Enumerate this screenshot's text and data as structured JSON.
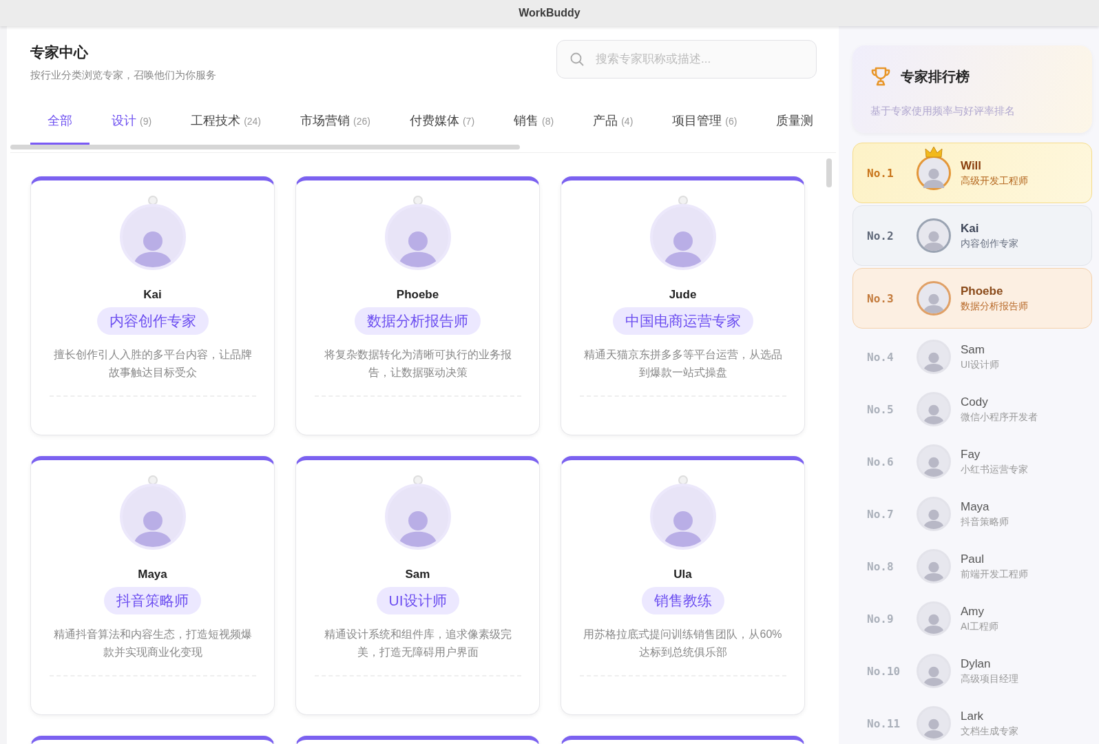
{
  "window": {
    "title": "WorkBuddy"
  },
  "header": {
    "title": "专家中心",
    "subtitle": "按行业分类浏览专家，召唤他们为你服务"
  },
  "search": {
    "placeholder": "搜索专家职称或描述..."
  },
  "tabs": [
    {
      "label": "全部",
      "selected": true,
      "hover": false
    },
    {
      "label": "设计",
      "count": "(9)",
      "selected": false,
      "hover": true
    },
    {
      "label": "工程技术",
      "count": "(24)",
      "selected": false,
      "hover": false
    },
    {
      "label": "市场营销",
      "count": "(26)",
      "selected": false,
      "hover": false
    },
    {
      "label": "付费媒体",
      "count": "(7)",
      "selected": false,
      "hover": false
    },
    {
      "label": "销售",
      "count": "(8)",
      "selected": false,
      "hover": false
    },
    {
      "label": "产品",
      "count": "(4)",
      "selected": false,
      "hover": false
    },
    {
      "label": "项目管理",
      "count": "(6)",
      "selected": false,
      "hover": false
    },
    {
      "label": "质量测",
      "selected": false,
      "hover": false
    }
  ],
  "experts": [
    {
      "name": "Kai",
      "role": "内容创作专家",
      "description": "擅长创作引人入胜的多平台内容，让品牌故事触达目标受众"
    },
    {
      "name": "Phoebe",
      "role": "数据分析报告师",
      "description": "将复杂数据转化为清晰可执行的业务报告，让数据驱动决策"
    },
    {
      "name": "Jude",
      "role": "中国电商运营专家",
      "description": "精通天猫京东拼多多等平台运营，从选品到爆款一站式操盘"
    },
    {
      "name": "Maya",
      "role": "抖音策略师",
      "description": "精通抖音算法和内容生态，打造短视频爆款并实现商业化变现"
    },
    {
      "name": "Sam",
      "role": "UI设计师",
      "description": "精通设计系统和组件库，追求像素级完美，打造无障碍用户界面"
    },
    {
      "name": "Ula",
      "role": "销售教练",
      "description": "用苏格拉底式提问训练销售团队，从60%达标到总统俱乐部"
    }
  ],
  "leaderboard": {
    "title": "专家排行榜",
    "subtitle": "基于专家使用频率与好评率排名",
    "items": [
      {
        "rank": "No.1",
        "name": "Will",
        "role": "高级开发工程师",
        "kind": "gold",
        "crown": true
      },
      {
        "rank": "No.2",
        "name": "Kai",
        "role": "内容创作专家",
        "kind": "silver",
        "crown": false
      },
      {
        "rank": "No.3",
        "name": "Phoebe",
        "role": "数据分析报告师",
        "kind": "bronze",
        "crown": false
      },
      {
        "rank": "No.4",
        "name": "Sam",
        "role": "UI设计师",
        "kind": "plain",
        "crown": false
      },
      {
        "rank": "No.5",
        "name": "Cody",
        "role": "微信小程序开发者",
        "kind": "plain",
        "crown": false
      },
      {
        "rank": "No.6",
        "name": "Fay",
        "role": "小红书运营专家",
        "kind": "plain",
        "crown": false
      },
      {
        "rank": "No.7",
        "name": "Maya",
        "role": "抖音策略师",
        "kind": "plain",
        "crown": false
      },
      {
        "rank": "No.8",
        "name": "Paul",
        "role": "前端开发工程师",
        "kind": "plain",
        "crown": false
      },
      {
        "rank": "No.9",
        "name": "Amy",
        "role": "AI工程师",
        "kind": "plain",
        "crown": false
      },
      {
        "rank": "No.10",
        "name": "Dylan",
        "role": "高级项目经理",
        "kind": "plain",
        "crown": false
      },
      {
        "rank": "No.11",
        "name": "Lark",
        "role": "文档生成专家",
        "kind": "plain",
        "crown": false
      }
    ]
  }
}
